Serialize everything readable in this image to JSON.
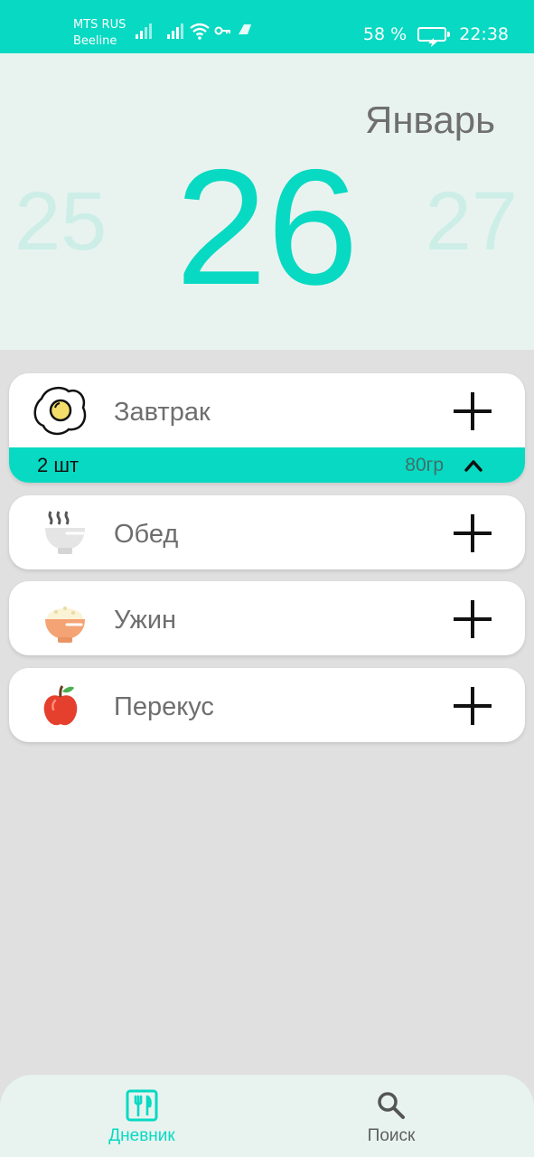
{
  "status_bar": {
    "carrier_line1": "MTS RUS",
    "carrier_line2": "Beeline",
    "battery_percent": "58 %",
    "time": "22:38",
    "background_color": "#08d9c2"
  },
  "date_picker": {
    "month": "Январь",
    "previous_day": "25",
    "current_day": "26",
    "next_day": "27",
    "accent_color": "#08d9c2"
  },
  "meals": [
    {
      "label": "Завтрак",
      "icon": "fried-egg-icon",
      "expanded": true,
      "entry": {
        "quantity": "2 шт",
        "weight": "80гр"
      }
    },
    {
      "label": "Обед",
      "icon": "soup-bowl-icon",
      "expanded": false
    },
    {
      "label": "Ужин",
      "icon": "rice-bowl-icon",
      "expanded": false
    },
    {
      "label": "Перекус",
      "icon": "apple-icon",
      "expanded": false
    }
  ],
  "bottom_nav": {
    "items": [
      {
        "label": "Дневник",
        "icon": "diary-utensils-icon",
        "active": true
      },
      {
        "label": "Поиск",
        "icon": "search-icon",
        "active": false
      }
    ]
  }
}
